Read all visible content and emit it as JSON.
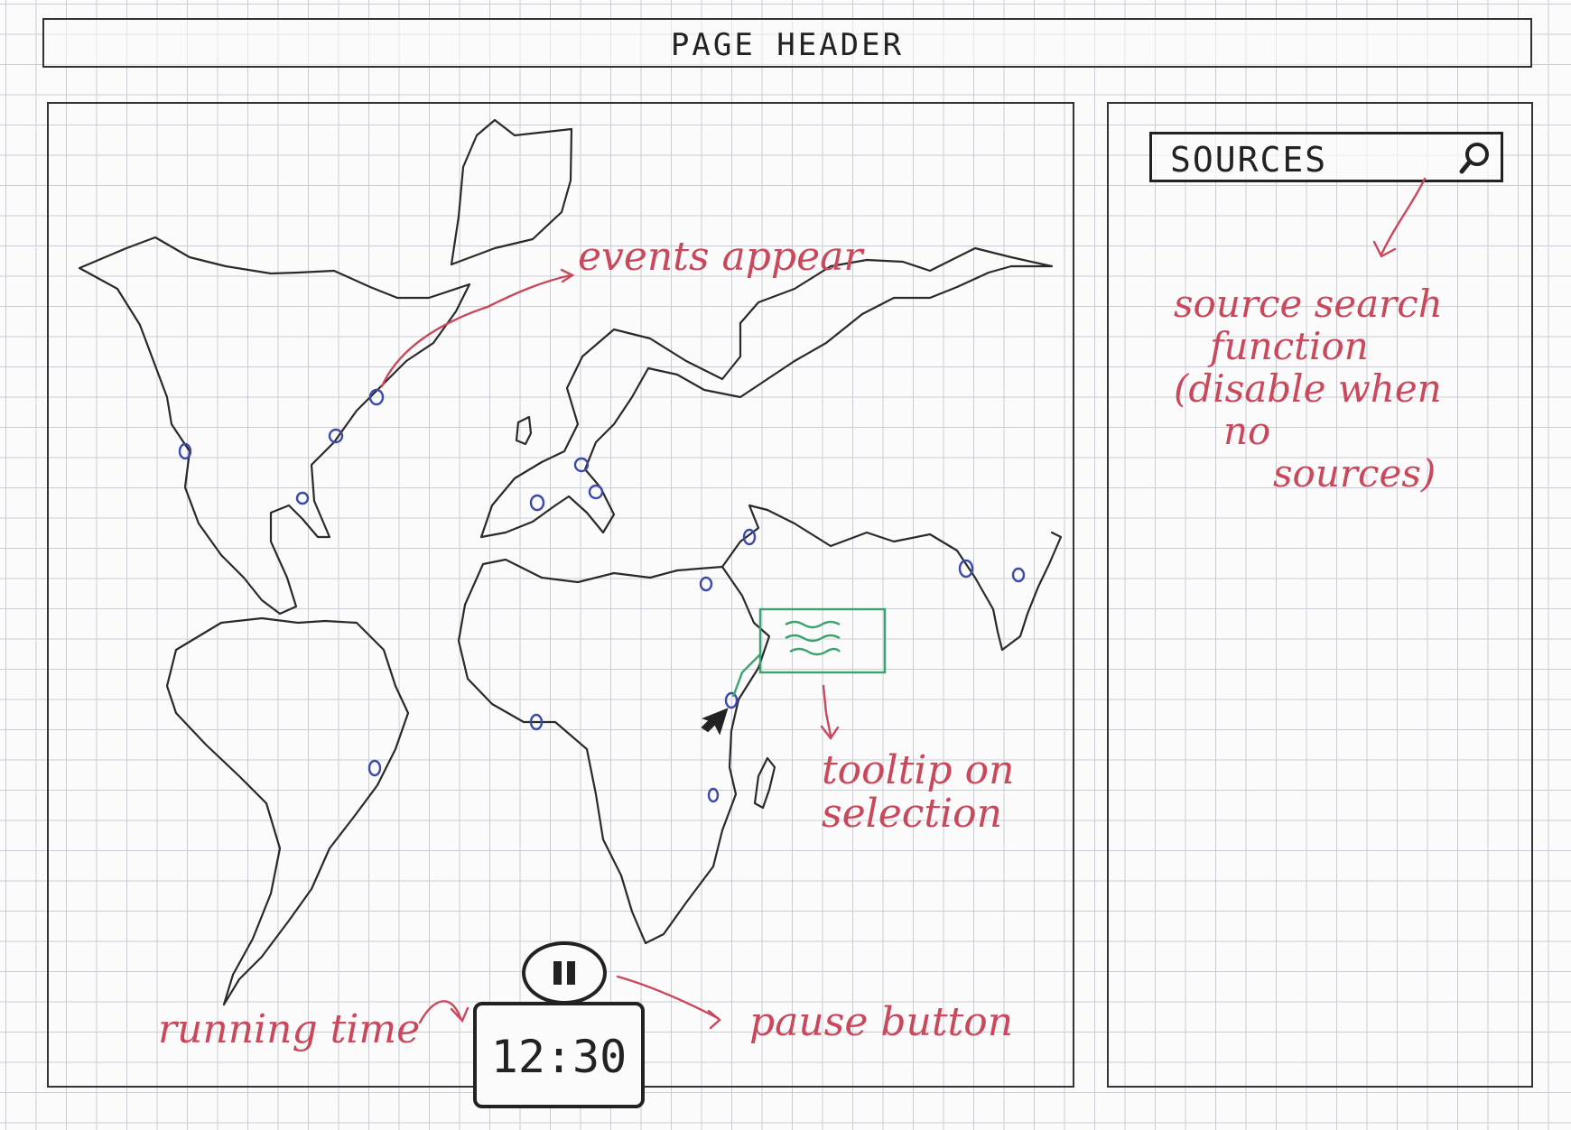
{
  "header": {
    "label": "PAGE HEADER"
  },
  "sidebar": {
    "search_label": "SOURCES",
    "search_icon": "magnifier-icon",
    "annotation_lines": [
      "source search",
      "function",
      "(disable when",
      "no",
      "sources)"
    ]
  },
  "map": {
    "annotation_events": "events appear",
    "annotation_tooltip_lines": [
      "tooltip on",
      "selection"
    ],
    "event_markers_count": 16
  },
  "controls": {
    "pause_icon": "pause-icon",
    "time_value": "12:30",
    "annotation_pause": "pause button",
    "annotation_time": "running time"
  },
  "colors": {
    "ink": "#222222",
    "annotation": "#c9485b",
    "marker": "#3b4aa8",
    "tooltip": "#3aa36f"
  }
}
